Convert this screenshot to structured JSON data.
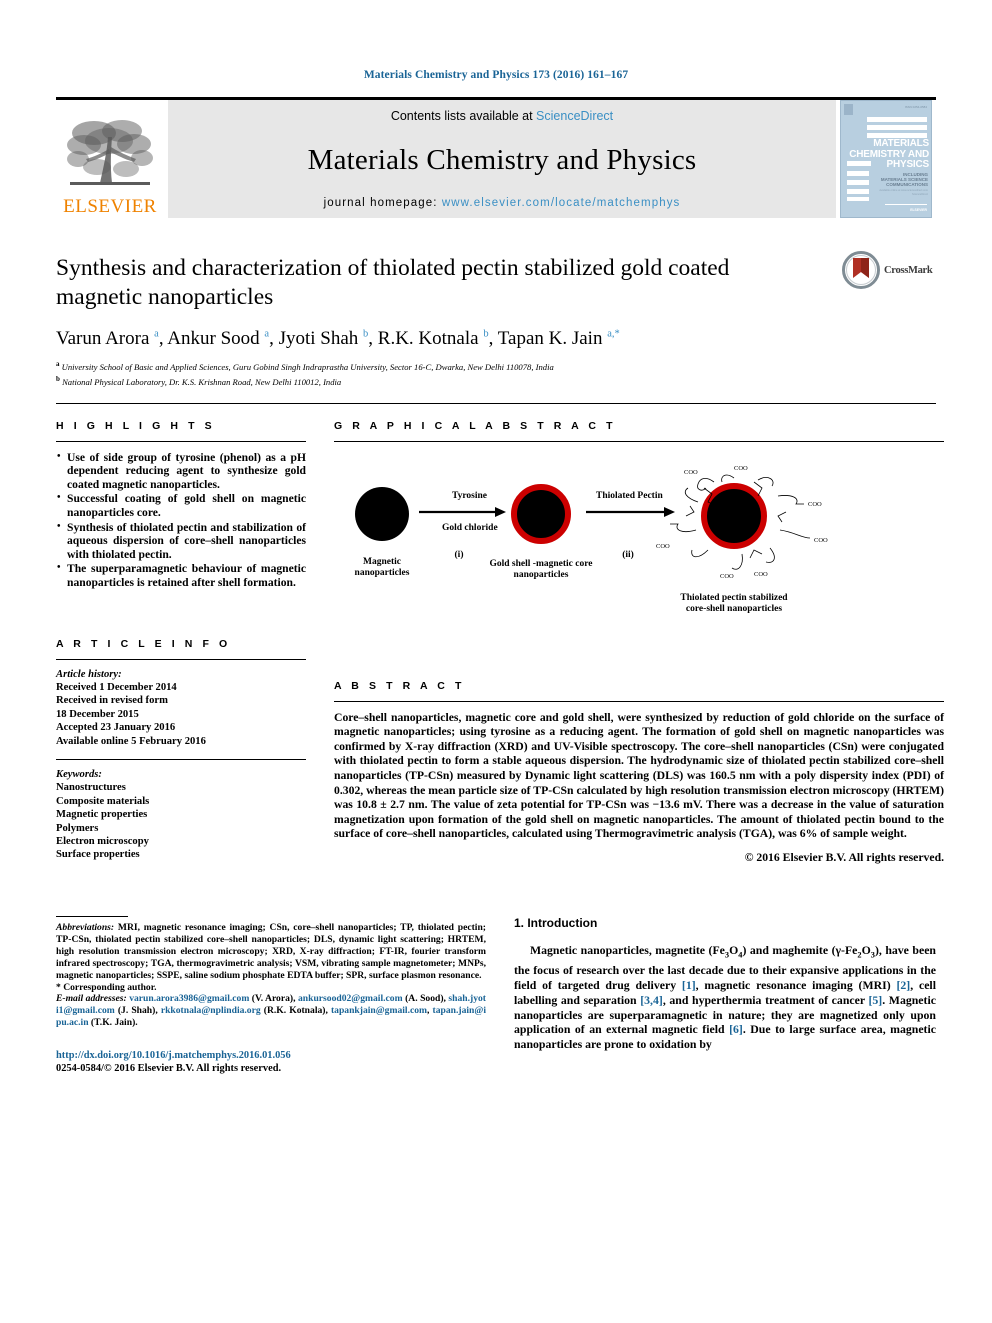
{
  "running_head": "Materials Chemistry and Physics 173 (2016) 161–167",
  "masthead": {
    "contents_prefix": "Contents lists available at ",
    "contents_link": "ScienceDirect",
    "journal_title": "Materials Chemistry and Physics",
    "homepage_label": "journal homepage: ",
    "homepage_url": "www.elsevier.com/locate/matchemphys",
    "publisher": "ELSEVIER",
    "cover": {
      "title_line1": "MATERIALS",
      "title_line2": "CHEMISTRY AND",
      "title_line3": "PHYSICS",
      "sub_line1": "INCLUDING",
      "sub_line2": "MATERIALS SCIENCE",
      "sub_line3": "COMMUNICATIONS",
      "footer": "ELSEVIER"
    }
  },
  "article": {
    "title": "Synthesis and characterization of thiolated pectin stabilized gold coated magnetic nanoparticles",
    "crossmark_label": "CrossMark",
    "authors": [
      {
        "name": "Varun Arora",
        "sup": "a"
      },
      {
        "name": "Ankur Sood",
        "sup": "a"
      },
      {
        "name": "Jyoti Shah",
        "sup": "b"
      },
      {
        "name": "R.K. Kotnala",
        "sup": "b"
      },
      {
        "name": "Tapan K. Jain",
        "sup": "a,"
      }
    ],
    "affiliations": [
      {
        "marker": "a",
        "text": "University School of Basic and Applied Sciences, Guru Gobind Singh Indraprastha University, Sector 16-C, Dwarka, New Delhi 110078, India"
      },
      {
        "marker": "b",
        "text": "National Physical Laboratory, Dr. K.S. Krishnan Road, New Delhi 110012, India"
      }
    ]
  },
  "highlights": {
    "heading": "H I G H L I G H T S",
    "items": [
      "Use of side group of tyrosine (phenol) as a pH dependent reducing agent to synthesize gold coated magnetic nanoparticles.",
      "Successful coating of gold shell on magnetic nanoparticles core.",
      "Synthesis of thiolated pectin and stabilization of aqueous dispersion of core–shell nanoparticles with thiolated pectin.",
      "The superparamagnetic behaviour of magnetic nanoparticles is retained after shell formation."
    ]
  },
  "graphical_abstract": {
    "heading": "G R A P H I C A L   A B S T R A C T",
    "labels": {
      "step1_top": "Tyrosine",
      "step1_bottom": "Gold chloride",
      "step1_roman": "(i)",
      "step2_top": "Thiolated Pectin",
      "step2_roman": "(ii)",
      "caption1_line1": "Magnetic",
      "caption1_line2": "nanoparticles",
      "caption2_line1": "Gold shell -magnetic core",
      "caption2_line2": "nanoparticles",
      "caption3_line1": "Thiolated pectin stabilized",
      "caption3_line2": "core-shell nanoparticles",
      "coo": "COO"
    },
    "colors": {
      "core": "#000000",
      "shell": "#cc0000"
    }
  },
  "article_info": {
    "heading": "A R T I C L E   I N F O",
    "history_label": "Article history:",
    "history": [
      "Received 1 December 2014",
      "Received in revised form",
      "18 December 2015",
      "Accepted 23 January 2016",
      "Available online 5 February 2016"
    ],
    "keywords_label": "Keywords:",
    "keywords": [
      "Nanostructures",
      "Composite materials",
      "Magnetic properties",
      "Polymers",
      "Electron microscopy",
      "Surface properties"
    ]
  },
  "abstract": {
    "heading": "A B S T R A C T",
    "text": "Core–shell nanoparticles, magnetic core and gold shell, were synthesized by reduction of gold chloride on the surface of magnetic nanoparticles; using tyrosine as a reducing agent. The formation of gold shell on magnetic nanoparticles was confirmed by X-ray diffraction (XRD) and UV-Visible spectroscopy. The core–shell nanoparticles (CSn) were conjugated with thiolated pectin to form a stable aqueous dispersion. The hydrodynamic size of thiolated pectin stabilized core–shell nanoparticles (TP-CSn) measured by Dynamic light scattering (DLS) was 160.5 nm with a poly dispersity index (PDI) of 0.302, whereas the mean particle size of TP-CSn calculated by high resolution transmission electron microscopy (HRTEM) was 10.8 ± 2.7 nm. The value of zeta potential for TP-CSn was −13.6 mV. There was a decrease in the value of saturation magnetization upon formation of the gold shell on magnetic nanoparticles. The amount of thiolated pectin bound to the surface of core–shell nanoparticles, calculated using Thermogravimetric analysis (TGA), was 6% of sample weight.",
    "copyright": "© 2016 Elsevier B.V. All rights reserved."
  },
  "footnotes": {
    "abbreviations_label": "Abbreviations:",
    "abbreviations_text": " MRI, magnetic resonance imaging; CSn, core–shell nanoparticles; TP, thiolated pectin; TP-CSn, thiolated pectin stabilized core–shell nanoparticles; DLS, dynamic light scattering; HRTEM, high resolution transmission electron microscopy; XRD, X-ray diffraction; FT-IR, fourier transform infrared spectroscopy; TGA, thermogravimetric analysis; VSM, vibrating sample magnetometer; MNPs, magnetic nanoparticles; SSPE, saline sodium phosphate EDTA buffer; SPR, surface plasmon resonance.",
    "corresponding": "* Corresponding author.",
    "email_label": "E-mail addresses:",
    "emails": [
      {
        "address": "varun.arora3986@gmail.com",
        "owner": " (V. Arora), "
      },
      {
        "address": "ankursood02@gmail.com",
        "owner": " (A. Sood), "
      },
      {
        "address": "shah.jyoti1@gmail.com",
        "owner": " (J. Shah), "
      },
      {
        "address": "rkkotnala@nplindia.org",
        "owner": " (R.K. Kotnala), "
      },
      {
        "address": "tapankjain@gmail.com",
        "owner": ", "
      },
      {
        "address": "tapan.jain@ipu.ac.in",
        "owner": " (T.K. Jain)."
      }
    ],
    "doi_url": "http://dx.doi.org/10.1016/j.matchemphys.2016.01.056",
    "issn_line": "0254-0584/© 2016 Elsevier B.V. All rights reserved."
  },
  "introduction": {
    "heading": "1. Introduction",
    "paragraph_parts": [
      {
        "t": "Magnetic nanoparticles, magnetite (Fe",
        "k": "n"
      },
      {
        "t": "3",
        "k": "sub"
      },
      {
        "t": "O",
        "k": "n"
      },
      {
        "t": "4",
        "k": "sub"
      },
      {
        "t": ") and maghemite (γ-Fe",
        "k": "n"
      },
      {
        "t": "2",
        "k": "sub"
      },
      {
        "t": "O",
        "k": "n"
      },
      {
        "t": "3",
        "k": "sub"
      },
      {
        "t": "), have been the focus of research over the last decade due to their expansive applications in the field of targeted drug delivery ",
        "k": "n"
      },
      {
        "t": "[1]",
        "k": "ref"
      },
      {
        "t": ", magnetic resonance imaging (MRI) ",
        "k": "n"
      },
      {
        "t": "[2]",
        "k": "ref"
      },
      {
        "t": ", cell labelling and separation ",
        "k": "n"
      },
      {
        "t": "[3,4]",
        "k": "ref"
      },
      {
        "t": ", and hyperthermia treatment of cancer ",
        "k": "n"
      },
      {
        "t": "[5]",
        "k": "ref"
      },
      {
        "t": ". Magnetic nanoparticles are superparamagnetic in nature; they are magnetized only upon application of an external magnetic field ",
        "k": "n"
      },
      {
        "t": "[6]",
        "k": "ref"
      },
      {
        "t": ". Due to large surface area, magnetic nanoparticles are prone to oxidation by",
        "k": "n"
      }
    ]
  },
  "colors": {
    "link": "#1a6496",
    "science_direct": "#3a8fc4",
    "elsevier_orange": "#ef8200",
    "cover_blue": "#b8cfe0",
    "crossmark_red": "#b03024"
  }
}
